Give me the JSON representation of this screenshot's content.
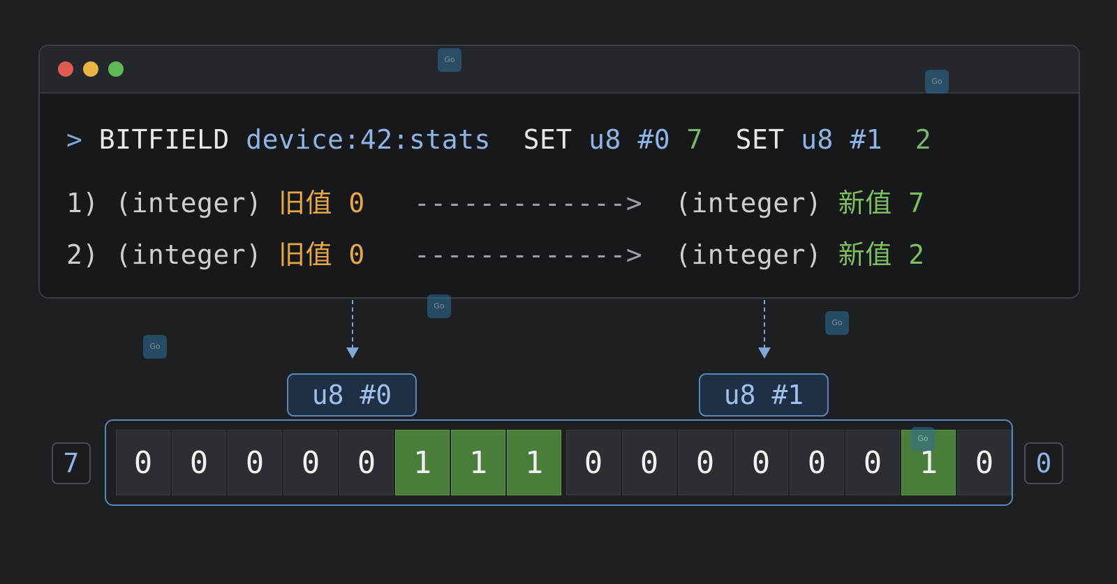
{
  "window": {
    "controls": [
      "close",
      "minimize",
      "maximize"
    ]
  },
  "terminal": {
    "command": {
      "prompt": ">",
      "name": "BITFIELD",
      "key": "device:42:stats",
      "op1": "SET",
      "type1": "u8",
      "offset1": "#0",
      "value1": "7",
      "op2": "SET",
      "type2": "u8",
      "offset2": "#1",
      "value2": "2"
    },
    "results": [
      {
        "index": "1)",
        "old_type": "(integer)",
        "old_label": "旧值",
        "old_value": "0",
        "arrow": "------------->",
        "new_type": "(integer)",
        "new_label": "新值",
        "new_value": "7"
      },
      {
        "index": "2)",
        "old_type": "(integer)",
        "old_label": "旧值",
        "old_value": "0",
        "arrow": "------------->",
        "new_type": "(integer)",
        "new_label": "新值",
        "new_value": "2"
      }
    ]
  },
  "fields": [
    {
      "label": "u8 #0"
    },
    {
      "label": "u8 #1"
    }
  ],
  "bits": {
    "left_side": "7",
    "right_side": "0",
    "field0": [
      "0",
      "0",
      "0",
      "0",
      "0",
      "1",
      "1",
      "1"
    ],
    "field1": [
      "0",
      "0",
      "0",
      "0",
      "0",
      "0",
      "1",
      "0"
    ]
  },
  "colors": {
    "bit_on": "#4a7d3a",
    "accent_blue": "#5d86b8",
    "old_value": "#e8a845",
    "new_value": "#7fbf62"
  }
}
